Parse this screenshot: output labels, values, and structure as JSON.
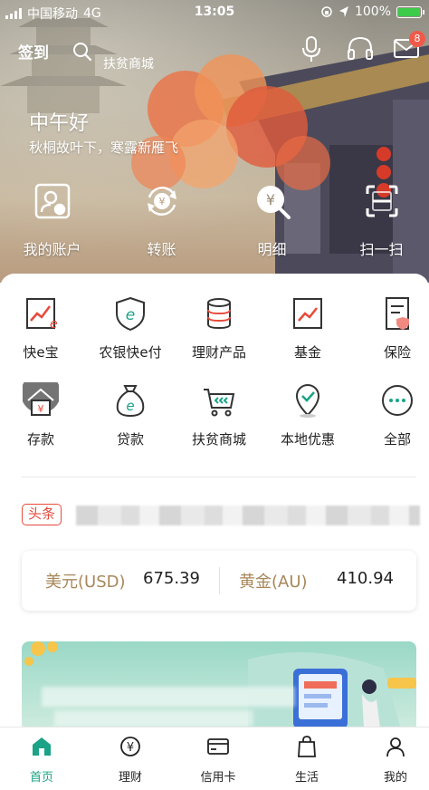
{
  "status_bar": {
    "carrier": "中国移动",
    "network": "4G",
    "time": "13:05",
    "battery": "100%",
    "battery_level": 1.0
  },
  "topbar": {
    "checkin": "签到",
    "search_placeholder": "扶贫商城",
    "message_badge": "8"
  },
  "greeting": {
    "title": "中午好",
    "subtitle": "秋桐故叶下，寒露新雁飞"
  },
  "quick_actions": [
    {
      "label": "我的账户",
      "icon": "account-icon"
    },
    {
      "label": "转账",
      "icon": "transfer-icon"
    },
    {
      "label": "明细",
      "icon": "details-icon"
    },
    {
      "label": "扫一扫",
      "icon": "scan-icon"
    }
  ],
  "services": [
    {
      "label": "快e宝",
      "icon": "kuaiebao-icon"
    },
    {
      "label": "农银快e付",
      "icon": "kuaiefu-icon"
    },
    {
      "label": "理财产品",
      "icon": "wealth-product-icon"
    },
    {
      "label": "基金",
      "icon": "fund-icon"
    },
    {
      "label": "保险",
      "icon": "insurance-icon"
    },
    {
      "label": "存款",
      "icon": "deposit-icon"
    },
    {
      "label": "贷款",
      "icon": "loan-icon"
    },
    {
      "label": "扶贫商城",
      "icon": "mall-cart-icon"
    },
    {
      "label": "本地优惠",
      "icon": "local-offer-icon"
    },
    {
      "label": "全部",
      "icon": "more-icon"
    }
  ],
  "news": {
    "tag": "头条"
  },
  "rates": {
    "usd_label": "美元(USD)",
    "usd_value": "675.39",
    "gold_label": "黄金(AU)",
    "gold_value": "410.94"
  },
  "bottom_nav": [
    {
      "label": "首页",
      "icon": "home-icon",
      "active": true
    },
    {
      "label": "理财",
      "icon": "yuan-circle-icon",
      "active": false
    },
    {
      "label": "信用卡",
      "icon": "credit-card-icon",
      "active": false
    },
    {
      "label": "生活",
      "icon": "shopping-bag-icon",
      "active": false
    },
    {
      "label": "我的",
      "icon": "user-icon",
      "active": false
    }
  ],
  "colors": {
    "accent": "#1aa386",
    "gold_label": "#a8875a",
    "news_tag": "#e54b3c",
    "badge": "#f05a4a",
    "battery": "#3ccc4a"
  }
}
